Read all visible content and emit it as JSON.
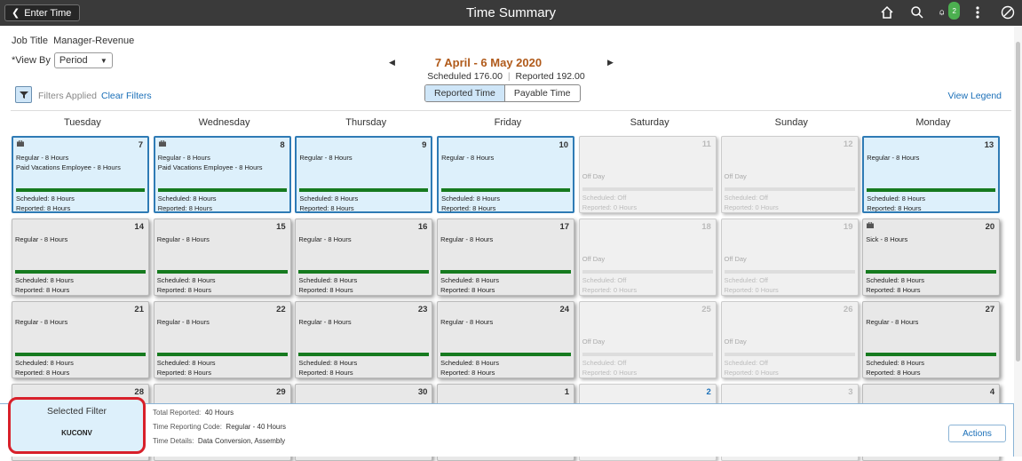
{
  "topbar": {
    "back_label": "Enter Time",
    "title": "Time Summary",
    "notification_count": "2",
    "icons": [
      "home-icon",
      "search-icon",
      "notification-icon",
      "more-icon",
      "navbar-icon"
    ]
  },
  "header": {
    "job_title_label": "Job Title",
    "job_title_value": "Manager-Revenue",
    "view_by_label": "*View By",
    "view_by_value": "Period",
    "date_range": "7 April - 6 May 2020",
    "scheduled_label": "Scheduled",
    "scheduled_value": "176.00",
    "reported_label": "Reported",
    "reported_value": "192.00",
    "tab_reported": "Reported Time",
    "tab_payable": "Payable Time",
    "filters_applied": "Filters Applied",
    "clear_filters": "Clear Filters",
    "view_legend": "View Legend"
  },
  "weekdays": [
    "Tuesday",
    "Wednesday",
    "Thursday",
    "Friday",
    "Saturday",
    "Sunday",
    "Monday"
  ],
  "cells": [
    {
      "day": "7",
      "type": "sel",
      "icon": true,
      "l1": "Regular - 8 Hours",
      "l2": "Paid Vacations Employee - 8 Hours",
      "s1": "Scheduled: 8 Hours",
      "s2": "Reported: 8 Hours"
    },
    {
      "day": "8",
      "type": "sel",
      "icon": true,
      "l1": "Regular - 8 Hours",
      "l2": "Paid Vacations Employee - 8 Hours",
      "s1": "Scheduled: 8 Hours",
      "s2": "Reported: 8 Hours"
    },
    {
      "day": "9",
      "type": "sel",
      "l1": "Regular - 8 Hours",
      "s1": "Scheduled: 8 Hours",
      "s2": "Reported: 8 Hours"
    },
    {
      "day": "10",
      "type": "sel",
      "l1": "Regular - 8 Hours",
      "s1": "Scheduled: 8 Hours",
      "s2": "Reported: 8 Hours"
    },
    {
      "day": "11",
      "type": "off",
      "offday": "Off Day",
      "s1": "Scheduled: Off",
      "s2": "Reported: 0 Hours"
    },
    {
      "day": "12",
      "type": "off",
      "offday": "Off Day",
      "s1": "Scheduled: Off",
      "s2": "Reported: 0 Hours"
    },
    {
      "day": "13",
      "type": "sel",
      "l1": "Regular - 8 Hours",
      "s1": "Scheduled: 8 Hours",
      "s2": "Reported: 8 Hours"
    },
    {
      "day": "14",
      "type": "work",
      "l1": "Regular - 8 Hours",
      "s1": "Scheduled: 8 Hours",
      "s2": "Reported: 8 Hours"
    },
    {
      "day": "15",
      "type": "work",
      "l1": "Regular - 8 Hours",
      "s1": "Scheduled: 8 Hours",
      "s2": "Reported: 8 Hours"
    },
    {
      "day": "16",
      "type": "work",
      "l1": "Regular - 8 Hours",
      "s1": "Scheduled: 8 Hours",
      "s2": "Reported: 8 Hours"
    },
    {
      "day": "17",
      "type": "work",
      "l1": "Regular - 8 Hours",
      "s1": "Scheduled: 8 Hours",
      "s2": "Reported: 8 Hours"
    },
    {
      "day": "18",
      "type": "off",
      "offday": "Off Day",
      "s1": "Scheduled: Off",
      "s2": "Reported: 0 Hours"
    },
    {
      "day": "19",
      "type": "off",
      "offday": "Off Day",
      "s1": "Scheduled: Off",
      "s2": "Reported: 0 Hours"
    },
    {
      "day": "20",
      "type": "work",
      "icon": true,
      "l1": "Sick - 8 Hours",
      "s1": "Scheduled: 8 Hours",
      "s2": "Reported: 8 Hours"
    },
    {
      "day": "21",
      "type": "work",
      "l1": "Regular - 8 Hours",
      "s1": "Scheduled: 8 Hours",
      "s2": "Reported: 8 Hours"
    },
    {
      "day": "22",
      "type": "work",
      "l1": "Regular - 8 Hours",
      "s1": "Scheduled: 8 Hours",
      "s2": "Reported: 8 Hours"
    },
    {
      "day": "23",
      "type": "work",
      "l1": "Regular - 8 Hours",
      "s1": "Scheduled: 8 Hours",
      "s2": "Reported: 8 Hours"
    },
    {
      "day": "24",
      "type": "work",
      "l1": "Regular - 8 Hours",
      "s1": "Scheduled: 8 Hours",
      "s2": "Reported: 8 Hours"
    },
    {
      "day": "25",
      "type": "off",
      "offday": "Off Day",
      "s1": "Scheduled: Off",
      "s2": "Reported: 0 Hours"
    },
    {
      "day": "26",
      "type": "off",
      "offday": "Off Day",
      "s1": "Scheduled: Off",
      "s2": "Reported: 0 Hours"
    },
    {
      "day": "27",
      "type": "work",
      "l1": "Regular - 8 Hours",
      "s1": "Scheduled: 8 Hours",
      "s2": "Reported: 8 Hours"
    },
    {
      "day": "28",
      "type": "work"
    },
    {
      "day": "29",
      "type": "work"
    },
    {
      "day": "30",
      "type": "work"
    },
    {
      "day": "1",
      "type": "work"
    },
    {
      "day": "2",
      "type": "off",
      "blue": true
    },
    {
      "day": "3",
      "type": "off"
    },
    {
      "day": "4",
      "type": "work"
    }
  ],
  "footer": {
    "selected_filter_label": "Selected Filter",
    "selected_filter_value": "KUCONV",
    "total_reported_label": "Total Reported:",
    "total_reported_value": "40 Hours",
    "trc_label": "Time Reporting Code:",
    "trc_value": "Regular - 40 Hours",
    "details_label": "Time Details:",
    "details_value": "Data Conversion, Assembly",
    "actions_label": "Actions"
  },
  "colors": {
    "topbar": "#3a3a3a",
    "date_range": "#b05a1a",
    "link": "#1a6fb8",
    "selected_cell": "#ddf0fb",
    "bar_green": "#167a1f",
    "highlight_red": "#d8202a"
  }
}
